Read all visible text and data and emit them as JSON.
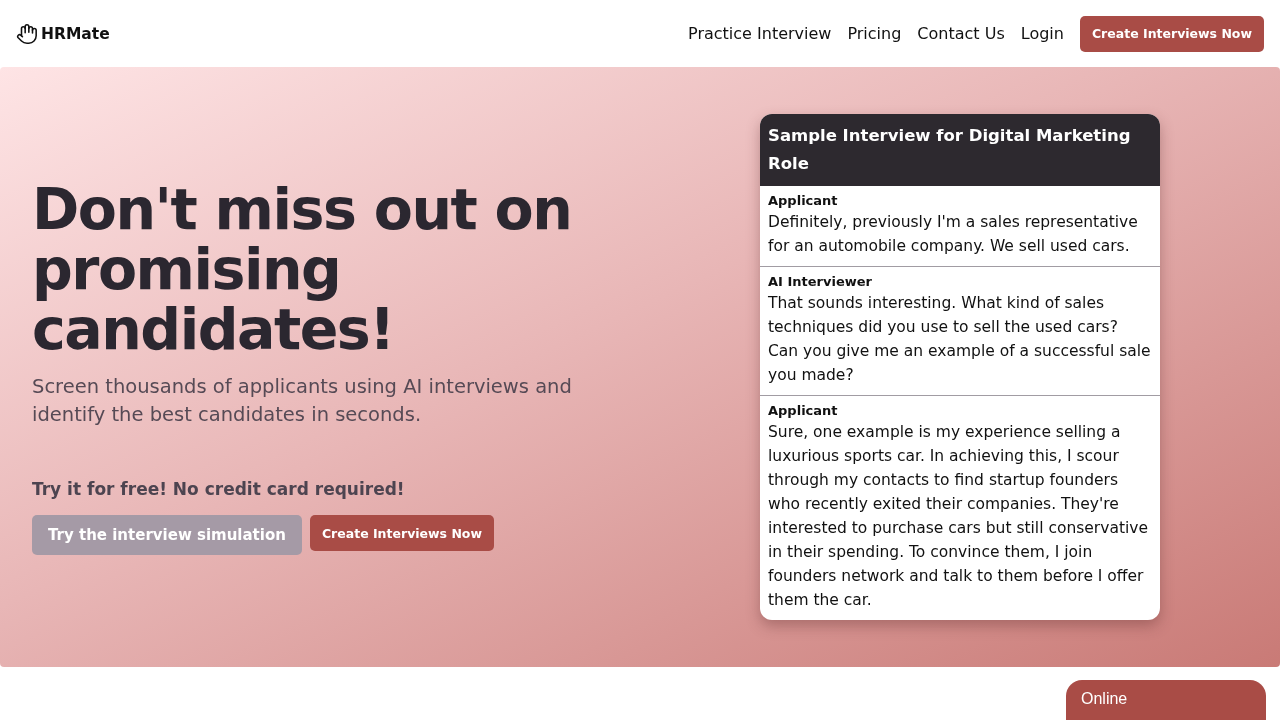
{
  "nav": {
    "brand": "HRMate",
    "links": [
      "Practice Interview",
      "Pricing",
      "Contact Us",
      "Login"
    ],
    "cta": "Create Interviews Now"
  },
  "hero": {
    "title": "Don't miss out on promising candidates!",
    "subtitle": "Screen thousands of applicants using AI interviews and identify the best candidates in seconds.",
    "free_note": "Try it for free! No credit card required!",
    "buttons": [
      {
        "label": "Try the interview simulation",
        "kind": "secondary"
      },
      {
        "label": "Create Interviews Now",
        "kind": "primary"
      }
    ]
  },
  "sample": {
    "title": "Sample Interview for Digital Marketing Role",
    "messages": [
      {
        "speaker": "Applicant",
        "text": "Definitely, previously I'm a sales representative for an automobile company. We sell used cars."
      },
      {
        "speaker": "AI Interviewer",
        "text": "That sounds interesting. What kind of sales techniques did you use to sell the used cars? Can you give me an example of a successful sale you made?"
      },
      {
        "speaker": "Applicant",
        "text": "Sure, one example is my experience selling a luxurious sports car. In achieving this, I scour through my contacts to find startup founders who recently exited their companies. They're interested to purchase cars but still conservative in their spending. To convince them, I join founders network and talk to them before I offer them the car."
      }
    ]
  },
  "chat_widget": {
    "label": "Online"
  }
}
